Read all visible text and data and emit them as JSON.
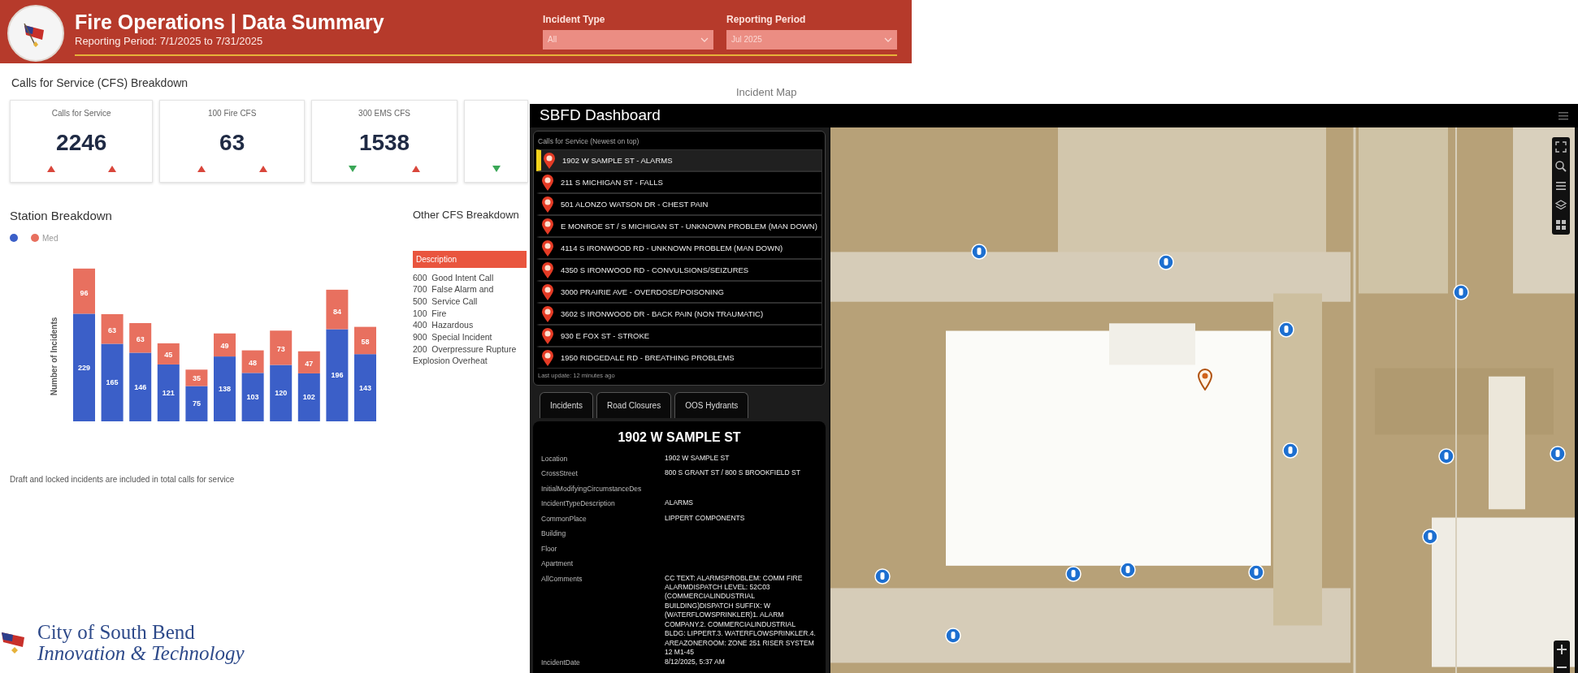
{
  "header": {
    "title": "Fire Operations | Data Summary",
    "subtitle": "Reporting Period: 7/1/2025 to 7/31/2025",
    "filters": [
      {
        "label": "Incident Type",
        "value": "All"
      },
      {
        "label": "Reporting Period",
        "value": "Jul 2025"
      }
    ]
  },
  "cfs_section": {
    "title": "Calls for Service (CFS) Breakdown",
    "cards": [
      {
        "label": "Calls for Service",
        "value": "2246",
        "trends": [
          {
            "kind": "up"
          },
          {
            "kind": "up"
          }
        ]
      },
      {
        "label": "100  Fire CFS",
        "value": "63",
        "trends": [
          {
            "kind": "up"
          },
          {
            "kind": "up"
          }
        ]
      },
      {
        "label": "300  EMS CFS",
        "value": "1538",
        "trends": [
          {
            "kind": "down"
          },
          {
            "kind": "up"
          }
        ]
      },
      {
        "trends": [
          {
            "kind": "down"
          }
        ]
      }
    ]
  },
  "station_breakdown": {
    "title": "Station Breakdown",
    "chart_data": {
      "type": "bar",
      "stacked": true,
      "ylabel": "Number of Incidents",
      "data_labels": true,
      "series": [
        {
          "color": "#3b5fc8",
          "values": [
            229,
            165,
            146,
            121,
            75,
            138,
            103,
            120,
            102,
            196,
            143
          ]
        },
        {
          "name": "Med",
          "color": "#e8705f",
          "values": [
            96,
            63,
            63,
            45,
            35,
            49,
            48,
            73,
            47,
            84,
            58
          ]
        }
      ]
    },
    "note": "Draft and locked incidents are included in total calls for service"
  },
  "other_cfs": {
    "title": "Other CFS Breakdown",
    "column": "Description",
    "rows": [
      {
        "code": "600",
        "description": "Good Intent Call"
      },
      {
        "code": "700",
        "description": "False Alarm and"
      },
      {
        "code": "500",
        "description": "Service Call"
      },
      {
        "code": "100",
        "description": "Fire"
      },
      {
        "code": "400",
        "description": "Hazardous"
      },
      {
        "code": "900",
        "description": "Special Incident"
      },
      {
        "code": "200",
        "description": "Overpressure Rupture Explosion Overheat"
      }
    ]
  },
  "incident_map": {
    "title": "Incident Map"
  },
  "footer_logo": {
    "name": "City of South Bend",
    "tagline": "Innovation & Technology"
  },
  "dashboard": {
    "title": "SBFD Dashboard",
    "list_title": "Calls for Service (Newest on top)",
    "calls": [
      {
        "text": "1902 W SAMPLE ST - ALARMS",
        "selected": true
      },
      {
        "text": "211 S MICHIGAN ST - FALLS",
        "selected": false
      },
      {
        "text": "501 ALONZO WATSON DR - CHEST PAIN",
        "selected": false
      },
      {
        "text": "E MONROE ST / S MICHIGAN ST - UNKNOWN PROBLEM (MAN DOWN)",
        "selected": false
      },
      {
        "text": "4114 S IRONWOOD RD - UNKNOWN PROBLEM (MAN DOWN)",
        "selected": false
      },
      {
        "text": "4350 S IRONWOOD RD - CONVULSIONS/SEIZURES",
        "selected": false
      },
      {
        "text": "3000 PRAIRIE AVE - OVERDOSE/POISONING",
        "selected": false
      },
      {
        "text": "3602 S IRONWOOD DR - BACK PAIN (NON TRAUMATIC)",
        "selected": false
      },
      {
        "text": "930 E FOX ST - STROKE",
        "selected": false
      },
      {
        "text": "1950 RIDGEDALE RD - BREATHING PROBLEMS",
        "selected": false
      }
    ],
    "last_update": "Last update: 12 minutes ago",
    "tabs": [
      {
        "label": "Incidents"
      },
      {
        "label": "Road Closures"
      },
      {
        "label": "OOS Hydrants"
      }
    ],
    "detail": {
      "title": "1902 W SAMPLE ST",
      "fields": [
        {
          "label": "Location",
          "value": "1902 W SAMPLE ST"
        },
        {
          "label": "CrossStreet",
          "value": "800 S GRANT ST / 800 S BROOKFIELD ST"
        },
        {
          "label": "InitialModifyingCircumstanceDes"
        },
        {
          "label": "IncidentTypeDescription",
          "value": "ALARMS"
        },
        {
          "label": "CommonPlace",
          "value": "LIPPERT COMPONENTS"
        },
        {
          "label": "Building"
        },
        {
          "label": "Floor"
        },
        {
          "label": "Apartment"
        },
        {
          "label": "AllComments",
          "value": "CC TEXT: ALARMSPROBLEM: COMM FIRE ALARMDISPATCH LEVEL: 52C03 (COMMERCIALINDUSTRIAL BUILDING)DISPATCH SUFFIX: W (WATERFLOWSPRINKLER)1. ALARM COMPANY.2. COMMERCIALINDUSTRIAL BLDG: LIPPERT.3. WATERFLOWSPRINKLER.4. AREAZONEROOM: ZONE 251 RISER SYSTEM 12 M1-45"
        },
        {
          "label": "IncidentDate",
          "value": "8/12/2025, 5:37 AM"
        }
      ]
    }
  }
}
